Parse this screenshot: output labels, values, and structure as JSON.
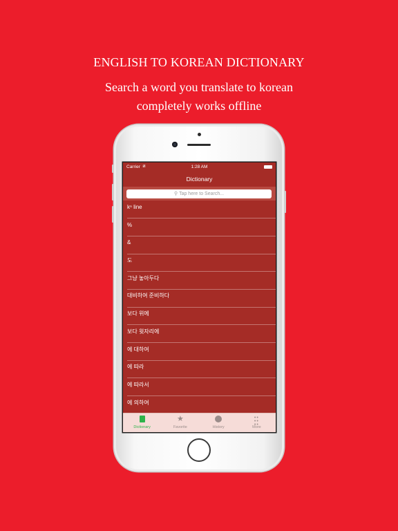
{
  "promo": {
    "title": "ENGLISH TO KOREAN DICTIONARY",
    "subtitle_line1": "Search a word you translate to korean",
    "subtitle_line2": "completely works offline"
  },
  "status_bar": {
    "carrier": "Carrier",
    "wifi_icon": "wifi-icon",
    "time": "1:28 AM",
    "battery_icon": "battery-icon"
  },
  "nav": {
    "title": "Dictionary"
  },
  "search": {
    "placeholder": "Tap here to Search..."
  },
  "entries": [
    "kⁿ line",
    "%",
    "&",
    "도",
    "그냥 놓아두다",
    "대비하여 준비하다",
    "보다 위에",
    "보다 윗자리에",
    "에 대하여",
    "에 따라",
    "에 따라서",
    "에 의하여"
  ],
  "tabs": [
    {
      "label": "Dictionary",
      "icon": "book-icon",
      "active": true
    },
    {
      "label": "Favorite",
      "icon": "star-icon",
      "active": false
    },
    {
      "label": "History",
      "icon": "clock-icon",
      "active": false
    },
    {
      "label": "More",
      "icon": "more-icon",
      "active": false
    }
  ],
  "colors": {
    "background": "#ec1d2b",
    "list_background": "#a52c26",
    "tab_active": "#2db34a",
    "tab_bar": "#f6dcd8"
  }
}
